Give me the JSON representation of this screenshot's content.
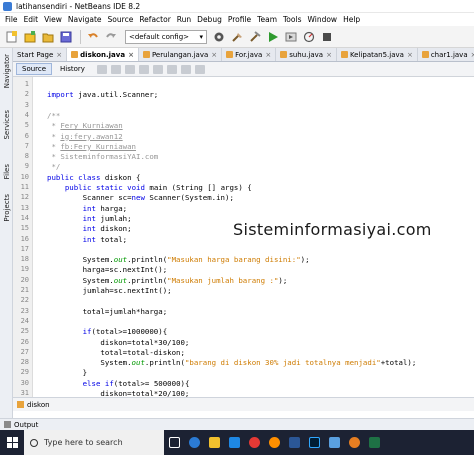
{
  "window": {
    "title": "latihansendiri - NetBeans IDE 8.2"
  },
  "menu": [
    "File",
    "Edit",
    "View",
    "Navigate",
    "Source",
    "Refactor",
    "Run",
    "Debug",
    "Profile",
    "Team",
    "Tools",
    "Window",
    "Help"
  ],
  "toolbar": {
    "config": "<default config>"
  },
  "left_panels": [
    "Navigator",
    "Services",
    "Files",
    "Projects"
  ],
  "tabs": [
    "Start Page",
    "diskon.java",
    "Perulangan.java",
    "For.java",
    "suhu.java",
    "Kelipatan5.java",
    "char1.java"
  ],
  "active_tab": "diskon.java",
  "subtabs": {
    "source": "Source",
    "history": "History"
  },
  "code_lines": [
    {
      "n": "1",
      "t": ""
    },
    {
      "n": "2",
      "t": "import java.util.Scanner;"
    },
    {
      "n": "3",
      "t": ""
    },
    {
      "n": "4",
      "t": "/**"
    },
    {
      "n": "5",
      "t": " * Fery Kurniawan"
    },
    {
      "n": "6",
      "t": " * ig:fery.awan12"
    },
    {
      "n": "7",
      "t": " * fb:Fery Kurniawan"
    },
    {
      "n": "8",
      "t": " * SisteminformasiYAI.com"
    },
    {
      "n": "9",
      "t": " */"
    },
    {
      "n": "10",
      "t": "public class diskon {"
    },
    {
      "n": "11",
      "t": "    public static void main (String [] args) {"
    },
    {
      "n": "12",
      "t": "        Scanner sc=new Scanner(System.in);"
    },
    {
      "n": "13",
      "t": "        int harga;"
    },
    {
      "n": "14",
      "t": "        int jumlah;"
    },
    {
      "n": "15",
      "t": "        int diskon;"
    },
    {
      "n": "16",
      "t": "        int total;"
    },
    {
      "n": "17",
      "t": ""
    },
    {
      "n": "18",
      "t": "        System.out.println(\"Masukan harga barang disini:\");"
    },
    {
      "n": "19",
      "t": "        harga=sc.nextInt();"
    },
    {
      "n": "20",
      "t": "        System.out.println(\"Masukan jumlah barang :\");"
    },
    {
      "n": "21",
      "t": "        jumlah=sc.nextInt();"
    },
    {
      "n": "22",
      "t": ""
    },
    {
      "n": "23",
      "t": "        total=jumlah*harga;"
    },
    {
      "n": "24",
      "t": ""
    },
    {
      "n": "25",
      "t": "        if(total>=1000000){"
    },
    {
      "n": "26",
      "t": "            diskon=total*30/100;"
    },
    {
      "n": "27",
      "t": "            total=total-diskon;"
    },
    {
      "n": "28",
      "t": "            System.out.println(\"barang di diskon 30% jadi totalnya menjadi\"+total);"
    },
    {
      "n": "29",
      "t": "        }"
    },
    {
      "n": "30",
      "t": "        else if(total>= 500000){"
    },
    {
      "n": "31",
      "t": "            diskon=total*20/100;"
    }
  ],
  "watermark": "Sisteminformasiyai.com",
  "navigator_crumb": "diskon",
  "output_label": "Output",
  "taskbar": {
    "search_placeholder": "Type here to search"
  }
}
